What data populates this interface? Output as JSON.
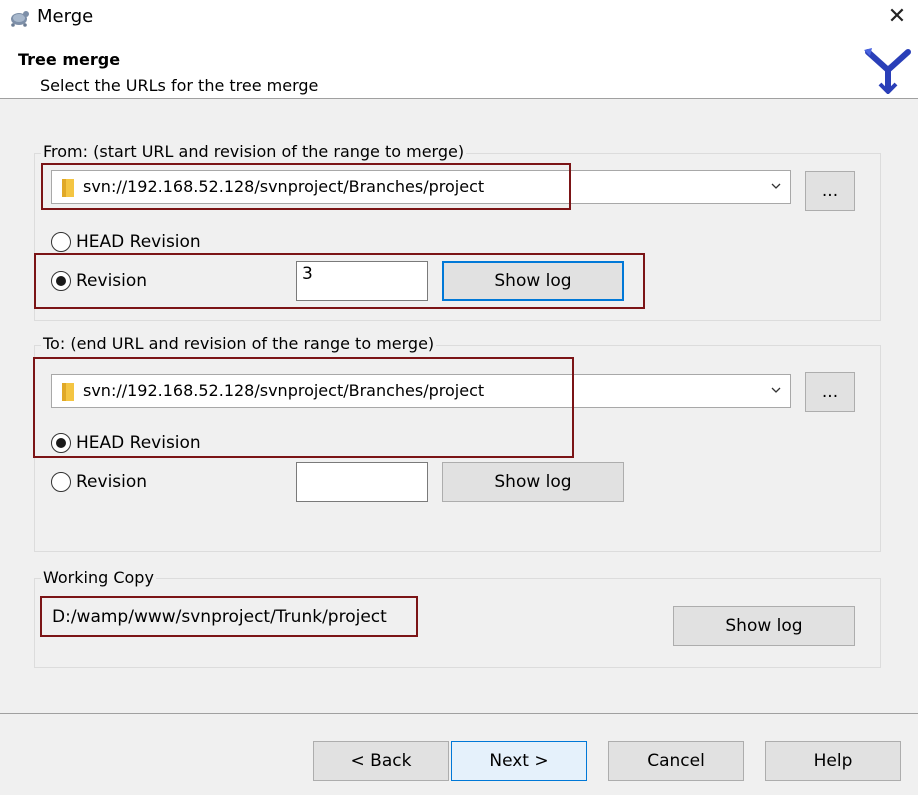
{
  "window": {
    "title": "Merge",
    "close_glyph": "✕"
  },
  "header": {
    "title": "Tree merge",
    "subtitle": "Select the URLs for the tree merge"
  },
  "from": {
    "group_label": "From: (start URL and revision of the range to merge)",
    "url": "svn://192.168.52.128/svnproject/Branches/project",
    "browse_label": "...",
    "head_label": "HEAD Revision",
    "revision_label": "Revision",
    "revision_value": "3",
    "selected": "revision",
    "show_log_label": "Show log"
  },
  "to": {
    "group_label": "To: (end URL and revision of the range to merge)",
    "url": "svn://192.168.52.128/svnproject/Branches/project",
    "browse_label": "...",
    "head_label": "HEAD Revision",
    "revision_label": "Revision",
    "revision_value": "",
    "selected": "head",
    "show_log_label": "Show log"
  },
  "working_copy": {
    "group_label": "Working Copy",
    "path": "D:/wamp/www/svnproject/Trunk/project",
    "show_log_label": "Show log"
  },
  "footer": {
    "back_label": "< Back",
    "next_label": "Next >",
    "cancel_label": "Cancel",
    "help_label": "Help"
  },
  "colors": {
    "highlight_box": "#7b1416",
    "focus_blue": "#0078d7",
    "folder_yellow": "#f4c542"
  },
  "icons": {
    "app": "tortoise-icon",
    "logo": "merge-arrows-icon",
    "folder": "folder-icon",
    "dropdown": "chevron-down-icon"
  }
}
